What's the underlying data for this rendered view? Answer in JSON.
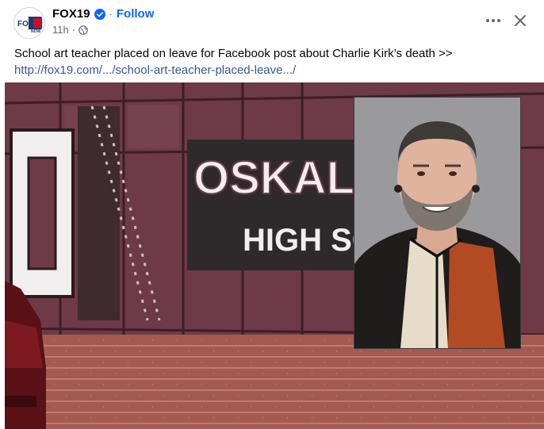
{
  "post": {
    "page_name": "FOX19",
    "follow_separator": "·",
    "follow_label": "Follow",
    "timestamp": "11h",
    "meta_separator": "·",
    "audience_icon": "globe-icon",
    "text": "School art teacher placed on leave for Facebook post about Charlie Kirk’s death >>",
    "link_text": "http://fox19.com/.../school-art-teacher-placed-leave.../",
    "more_icon": "more-horizontal-icon",
    "close_icon": "close-icon",
    "verified_icon": "verified-badge-icon"
  },
  "avatar": {
    "logo_text": "FOX19",
    "logo_sub": "NOW"
  },
  "image": {
    "sign_line1": "OSKAL",
    "sign_line2": "HIGH SC",
    "block_letter": "O"
  },
  "colors": {
    "link": "#385898",
    "follow": "#0866ff",
    "verified": "#0866ff",
    "secondary_text": "#65676b",
    "building_maroon": "#6e3a48",
    "brick": "#a45a50",
    "photo_background": "#9a9a9c"
  }
}
